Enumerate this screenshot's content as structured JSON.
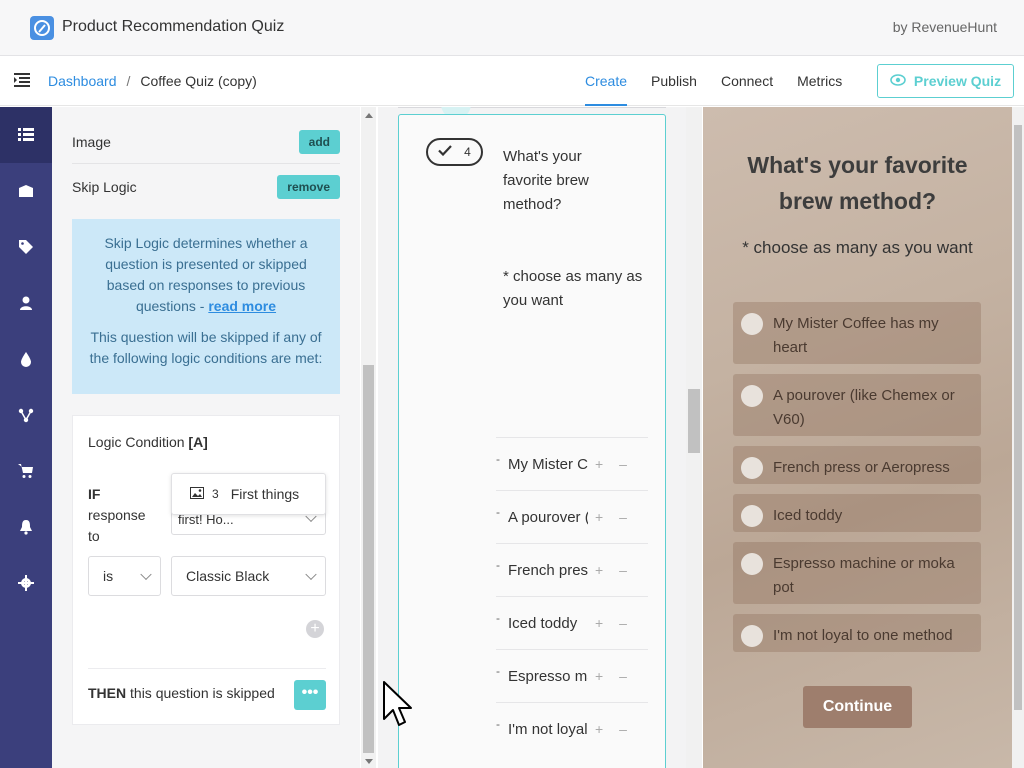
{
  "app": {
    "title": "Product Recommendation Quiz",
    "by": "by RevenueHunt"
  },
  "breadcrumb": {
    "dashboard": "Dashboard",
    "separator": "/",
    "current": "Coffee Quiz (copy)"
  },
  "tabs": [
    {
      "label": "Create",
      "active": true
    },
    {
      "label": "Publish",
      "active": false
    },
    {
      "label": "Connect",
      "active": false
    },
    {
      "label": "Metrics",
      "active": false
    }
  ],
  "preview_button": {
    "label": "Preview Quiz"
  },
  "sidebar_icons": [
    "list-icon",
    "box-icon",
    "tag-icon",
    "user-icon",
    "drop-icon",
    "share-icon",
    "cart-icon",
    "bell-icon",
    "gear-icon"
  ],
  "settings": {
    "image_label": "Image",
    "image_button": "add",
    "skip_logic_label": "Skip Logic",
    "skip_logic_button": "remove",
    "info_p1": "Skip Logic determines whether a question is presented or skipped based on responses to previous questions - ",
    "info_link": "read more",
    "info_p2": "This question will be skipped if any of the following logic conditions are met:",
    "logic_title": "Logic Condition ",
    "logic_id": "[A]",
    "if_label": "IF",
    "response_to": "response to",
    "dropdown_num": "3",
    "dropdown_label": "First things",
    "select_question_value": "first! Ho...",
    "is_value": "is",
    "answer_value": "Classic Black",
    "add_symbol": "+",
    "then_label": "THEN",
    "then_text": " this question is skipped",
    "dots": "•••"
  },
  "editor": {
    "question_number": "4",
    "question_text": "What's your favorite brew method?",
    "question_sub": "* choose as many as you want",
    "options": [
      "My Mister Coffee has my heart",
      "A pourover (like Chemex or V60)",
      "French press or Aeropress",
      "Iced toddy",
      "Espresso machine or moka pot",
      "I'm not loyal to one method"
    ],
    "drag_symbol": "-",
    "plusminus": "+ –"
  },
  "preview": {
    "title": "What's your favorite brew method?",
    "subtitle": "* choose as many as you want",
    "options": [
      "My Mister Coffee has my heart",
      "A pourover (like Chemex or V60)",
      "French press or Aeropress",
      "Iced toddy",
      "Espresso machine or moka pot",
      "I'm not loyal to one method"
    ],
    "continue_label": "Continue"
  }
}
